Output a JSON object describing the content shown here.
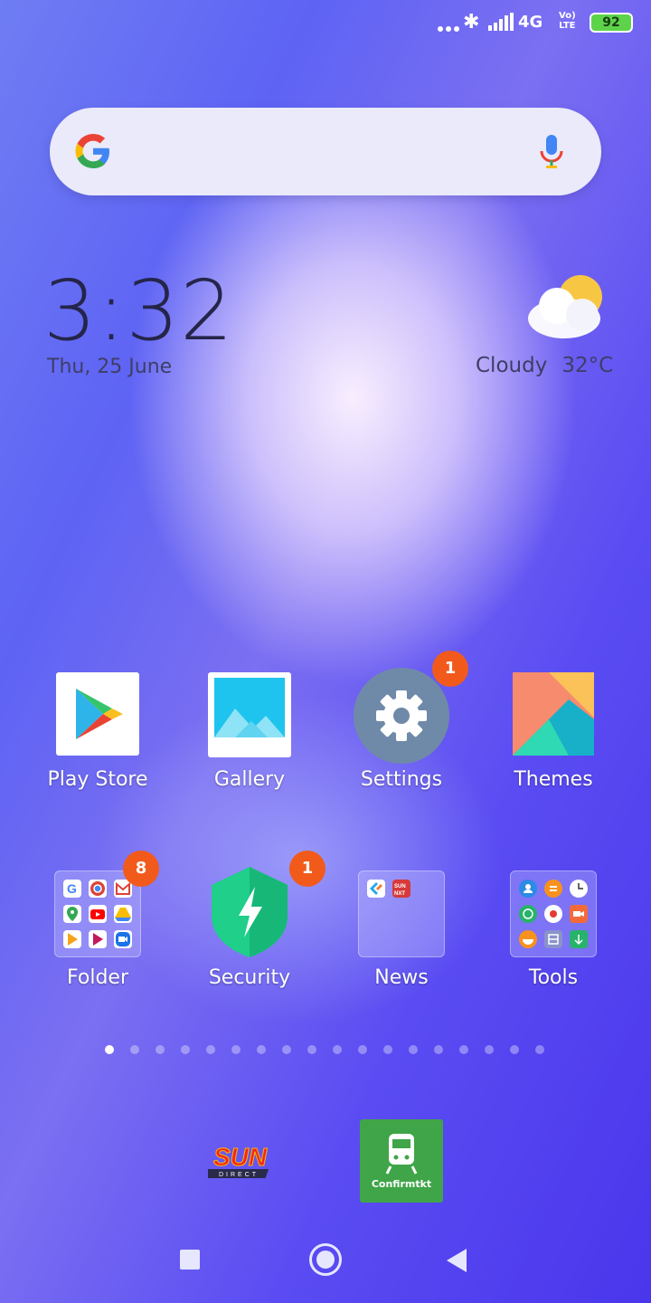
{
  "status_bar": {
    "network": "4G",
    "volte_top": "Vo)",
    "volte_bottom": "LTE",
    "battery": "92"
  },
  "clock": {
    "time": "3:32",
    "date": "Thu, 25 June"
  },
  "weather": {
    "condition": "Cloudy",
    "temperature": "32°C",
    "icon": "partly-cloudy-icon"
  },
  "apps_row1": [
    {
      "label": "Play Store",
      "icon": "play-store-icon",
      "badge": ""
    },
    {
      "label": "Gallery",
      "icon": "gallery-icon",
      "badge": ""
    },
    {
      "label": "Settings",
      "icon": "gear-icon",
      "badge": "1"
    },
    {
      "label": "Themes",
      "icon": "themes-icon",
      "badge": ""
    }
  ],
  "apps_row2": [
    {
      "label": "Folder",
      "icon": "folder-icon",
      "badge": "8"
    },
    {
      "label": "Security",
      "icon": "security-shield-icon",
      "badge": "1"
    },
    {
      "label": "News",
      "icon": "folder-icon",
      "badge": ""
    },
    {
      "label": "Tools",
      "icon": "folder-icon",
      "badge": ""
    }
  ],
  "pager": {
    "current_page": 1,
    "total_pages": 18
  },
  "dock": {
    "sun_logo_text": "SUN",
    "sun_sub_text": "DIRECT",
    "confirmtkt_label": "Confirmtkt"
  },
  "news_folder": {
    "mini_badge": "SUN NXT"
  },
  "colors": {
    "badge": "#f25a1c",
    "battery": "#5dd34a",
    "confirmtkt": "#3fa548"
  }
}
